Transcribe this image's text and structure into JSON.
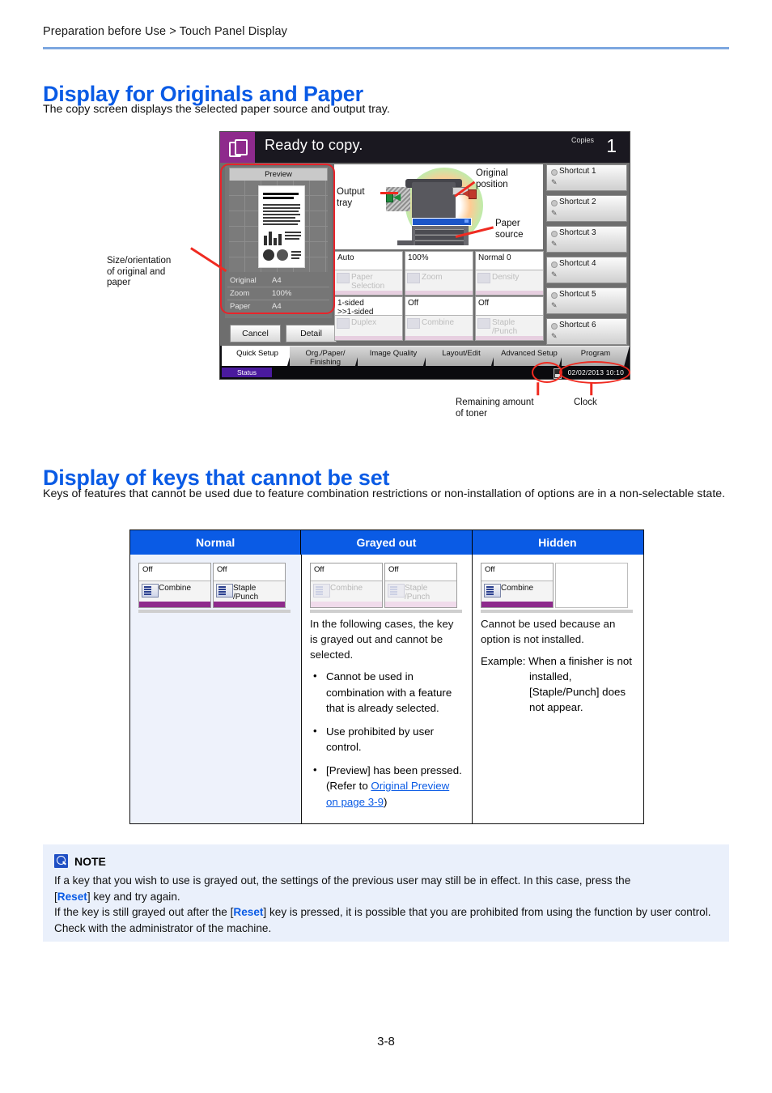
{
  "breadcrumb": "Preparation before Use > Touch Panel Display",
  "sections": {
    "originals_paper": {
      "heading": "Display for Originals and Paper",
      "intro": "The copy screen displays the selected paper source and output tray."
    },
    "keys_cannot_set": {
      "heading": "Display of keys that cannot be set",
      "intro": "Keys of features that cannot be used due to feature combination restrictions or non-installation of options are in a non-selectable state."
    }
  },
  "touch_panel": {
    "status_message": "Ready to copy.",
    "copies_label": "Copies",
    "copies_value": "1",
    "preview": {
      "tab_label": "Preview",
      "meta": [
        {
          "key": "Original",
          "value": "A4"
        },
        {
          "key": "Zoom",
          "value": "100%"
        },
        {
          "key": "Paper",
          "value": "A4"
        }
      ],
      "cancel_label": "Cancel",
      "detail_label": "Detail"
    },
    "function_keys": [
      {
        "value": "Auto",
        "name": "Paper Selection",
        "state": "grayed"
      },
      {
        "value": "100%",
        "name": "Zoom",
        "state": "grayed"
      },
      {
        "value": "Normal 0",
        "name": "Density",
        "state": "grayed"
      },
      {
        "value": "1-sided\n>>1-sided",
        "name": "Duplex",
        "state": "grayed"
      },
      {
        "value": "Off",
        "name": "Combine",
        "state": "grayed"
      },
      {
        "value": "Off",
        "name": "Staple /Punch",
        "state": "grayed"
      }
    ],
    "shortcuts": [
      "Shortcut 1",
      "Shortcut 2",
      "Shortcut 3",
      "Shortcut 4",
      "Shortcut 5",
      "Shortcut 6"
    ],
    "tabs": [
      {
        "label": "Quick Setup",
        "active": true
      },
      {
        "label": "Org./Paper/ Finishing",
        "active": false
      },
      {
        "label": "Image Quality",
        "active": false
      },
      {
        "label": "Layout/Edit",
        "active": false
      },
      {
        "label": "Advanced Setup",
        "active": false
      },
      {
        "label": "Program",
        "active": false
      }
    ],
    "status_bar": {
      "status_label": "Status",
      "clock": "02/02/2013  10:10"
    }
  },
  "callouts": {
    "size_orientation": "Size/orientation\nof original and\npaper",
    "output_tray": "Output\ntray",
    "original_position": "Original\nposition",
    "paper_source": "Paper\nsource",
    "remaining_toner": "Remaining amount\nof toner",
    "clock": "Clock"
  },
  "table": {
    "headers": [
      "Normal",
      "Grayed out",
      "Hidden"
    ],
    "normal": {
      "keys": [
        {
          "value": "Off",
          "name": "Combine",
          "state": "normal"
        },
        {
          "value": "Off",
          "name": "Staple /Punch",
          "state": "normal"
        }
      ]
    },
    "grayed": {
      "keys": [
        {
          "value": "Off",
          "name": "Combine",
          "state": "grayed"
        },
        {
          "value": "Off",
          "name": "Staple /Punch",
          "state": "grayed"
        }
      ],
      "intro": "In the following cases, the key is grayed out and cannot be selected.",
      "bullets": [
        "Cannot be used in combination with a feature that is already selected.",
        "Use prohibited by user control."
      ],
      "bullet3_pre": "[Preview] has been pressed.",
      "bullet3_refer_pre": "(Refer to ",
      "bullet3_link": "Original Preview on page 3-9",
      "bullet3_refer_post": ")"
    },
    "hidden": {
      "keys": [
        {
          "value": "Off",
          "name": "Combine",
          "state": "normal"
        },
        {
          "value": "",
          "name": "",
          "state": "empty"
        }
      ],
      "intro": "Cannot be used because an option is not installed.",
      "example": "Example: When a finisher is not installed, [Staple/Punch] does not appear."
    }
  },
  "note": {
    "title": "NOTE",
    "line1_a": "If a key that you wish to use is grayed out, the settings of the previous user may still be in effect. In this case, press the",
    "line1_b_pre": "[",
    "line1_b_kw": "Reset",
    "line1_b_post": "] key and try again.",
    "line2_pre": "If the key is still grayed out after the [",
    "line2_kw": "Reset",
    "line2_post": "] key is pressed, it is possible that you are prohibited from using the function by user control. Check with the administrator of the machine."
  },
  "page_number": "3-8",
  "colors": {
    "accent_blue": "#0a5be5",
    "rule_blue": "#7da7e0",
    "red_highlight": "#ef2b21",
    "panel_purple": "#8e2a8c",
    "note_bg": "#eaf0fb"
  }
}
